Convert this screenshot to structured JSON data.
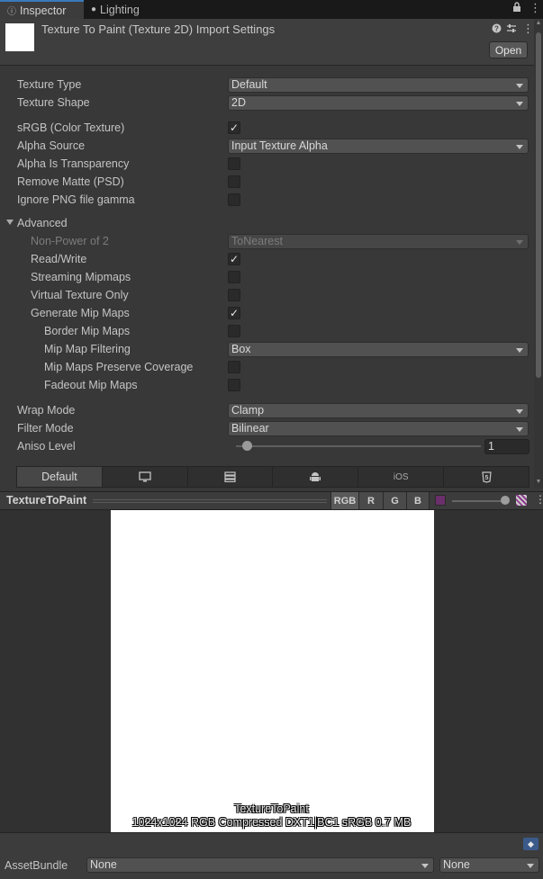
{
  "tabs": [
    {
      "label": "Inspector",
      "icon": "info-icon"
    },
    {
      "label": "Lighting",
      "icon": "bulb-icon"
    }
  ],
  "header": {
    "title": "Texture To Paint (Texture 2D) Import Settings",
    "open_label": "Open"
  },
  "props": {
    "texture_type": {
      "label": "Texture Type",
      "value": "Default"
    },
    "texture_shape": {
      "label": "Texture Shape",
      "value": "2D"
    },
    "srgb": {
      "label": "sRGB (Color Texture)",
      "checked": true
    },
    "alpha_source": {
      "label": "Alpha Source",
      "value": "Input Texture Alpha"
    },
    "alpha_transparency": {
      "label": "Alpha Is Transparency",
      "checked": false
    },
    "remove_matte": {
      "label": "Remove Matte (PSD)",
      "checked": false
    },
    "ignore_png_gamma": {
      "label": "Ignore PNG file gamma",
      "checked": false
    },
    "advanced": {
      "label": "Advanced"
    },
    "non_power_of_2": {
      "label": "Non-Power of 2",
      "value": "ToNearest"
    },
    "read_write": {
      "label": "Read/Write",
      "checked": true
    },
    "streaming_mipmaps": {
      "label": "Streaming Mipmaps",
      "checked": false
    },
    "virtual_texture_only": {
      "label": "Virtual Texture Only",
      "checked": false
    },
    "generate_mip_maps": {
      "label": "Generate Mip Maps",
      "checked": true
    },
    "border_mip_maps": {
      "label": "Border Mip Maps",
      "checked": false
    },
    "mip_map_filtering": {
      "label": "Mip Map Filtering",
      "value": "Box"
    },
    "mip_maps_preserve_coverage": {
      "label": "Mip Maps Preserve Coverage",
      "checked": false
    },
    "fadeout_mip_maps": {
      "label": "Fadeout Mip Maps",
      "checked": false
    },
    "wrap_mode": {
      "label": "Wrap Mode",
      "value": "Clamp"
    },
    "filter_mode": {
      "label": "Filter Mode",
      "value": "Bilinear"
    },
    "aniso_level": {
      "label": "Aniso Level",
      "value": "1"
    }
  },
  "platforms": [
    {
      "label": "Default",
      "icon": ""
    },
    {
      "label": "",
      "icon": "monitor-icon"
    },
    {
      "label": "",
      "icon": "server-icon"
    },
    {
      "label": "",
      "icon": "android-icon"
    },
    {
      "label": "iOS",
      "icon": ""
    },
    {
      "label": "",
      "icon": "html5-icon"
    }
  ],
  "preview": {
    "title": "TextureToPaint",
    "channels": [
      "RGB",
      "R",
      "G",
      "B"
    ],
    "overlay_name": "TextureToPaint",
    "overlay_info": "1024x1024  RGB Compressed DXT1|BC1 sRGB   0.7 MB"
  },
  "asset_bundle": {
    "label": "AssetBundle",
    "name_value": "None",
    "variant_value": "None"
  }
}
